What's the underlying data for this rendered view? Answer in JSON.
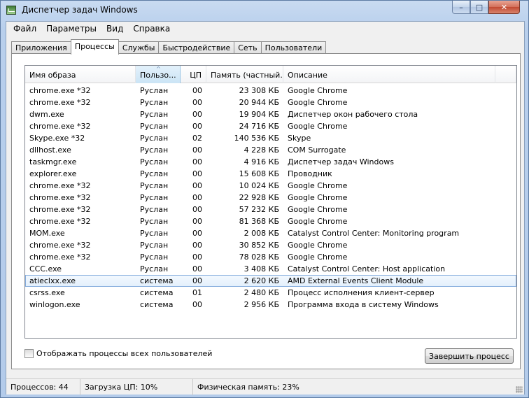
{
  "window": {
    "title": "Диспетчер задач Windows",
    "close_glyph": "✕",
    "max_glyph": "□",
    "min_glyph": "–"
  },
  "menu": [
    "Файл",
    "Параметры",
    "Вид",
    "Справка"
  ],
  "tabs": [
    "Приложения",
    "Процессы",
    "Службы",
    "Быстродействие",
    "Сеть",
    "Пользователи"
  ],
  "active_tab": 1,
  "columns": {
    "name": "Имя образа",
    "user": "Пользо...",
    "cpu": "ЦП",
    "memory": "Память (частный...",
    "description": "Описание",
    "sort_glyph": "^"
  },
  "processes": [
    {
      "name": "chrome.exe *32",
      "user": "Руслан",
      "cpu": "00",
      "memory": "23 308 КБ",
      "description": "Google Chrome"
    },
    {
      "name": "chrome.exe *32",
      "user": "Руслан",
      "cpu": "00",
      "memory": "20 944 КБ",
      "description": "Google Chrome"
    },
    {
      "name": "dwm.exe",
      "user": "Руслан",
      "cpu": "00",
      "memory": "19 904 КБ",
      "description": "Диспетчер окон рабочего стола"
    },
    {
      "name": "chrome.exe *32",
      "user": "Руслан",
      "cpu": "00",
      "memory": "24 716 КБ",
      "description": "Google Chrome"
    },
    {
      "name": "Skype.exe *32",
      "user": "Руслан",
      "cpu": "02",
      "memory": "140 536 КБ",
      "description": "Skype"
    },
    {
      "name": "dllhost.exe",
      "user": "Руслан",
      "cpu": "00",
      "memory": "4 228 КБ",
      "description": "COM Surrogate"
    },
    {
      "name": "taskmgr.exe",
      "user": "Руслан",
      "cpu": "00",
      "memory": "4 916 КБ",
      "description": "Диспетчер задач Windows"
    },
    {
      "name": "explorer.exe",
      "user": "Руслан",
      "cpu": "00",
      "memory": "15 608 КБ",
      "description": "Проводник"
    },
    {
      "name": "chrome.exe *32",
      "user": "Руслан",
      "cpu": "00",
      "memory": "10 024 КБ",
      "description": "Google Chrome"
    },
    {
      "name": "chrome.exe *32",
      "user": "Руслан",
      "cpu": "00",
      "memory": "22 928 КБ",
      "description": "Google Chrome"
    },
    {
      "name": "chrome.exe *32",
      "user": "Руслан",
      "cpu": "00",
      "memory": "57 232 КБ",
      "description": "Google Chrome"
    },
    {
      "name": "chrome.exe *32",
      "user": "Руслан",
      "cpu": "00",
      "memory": "81 368 КБ",
      "description": "Google Chrome"
    },
    {
      "name": "MOM.exe",
      "user": "Руслан",
      "cpu": "00",
      "memory": "2 008 КБ",
      "description": "Catalyst Control Center: Monitoring program"
    },
    {
      "name": "chrome.exe *32",
      "user": "Руслан",
      "cpu": "00",
      "memory": "30 852 КБ",
      "description": "Google Chrome"
    },
    {
      "name": "chrome.exe *32",
      "user": "Руслан",
      "cpu": "00",
      "memory": "78 028 КБ",
      "description": "Google Chrome"
    },
    {
      "name": "CCC.exe",
      "user": "Руслан",
      "cpu": "00",
      "memory": "3 408 КБ",
      "description": "Catalyst Control Center: Host application"
    },
    {
      "name": "atieclxx.exe",
      "user": "система",
      "cpu": "00",
      "memory": "2 620 КБ",
      "description": "AMD External Events Client Module",
      "selected": true
    },
    {
      "name": "csrss.exe",
      "user": "система",
      "cpu": "01",
      "memory": "2 480 КБ",
      "description": "Процесс исполнения клиент-сервер"
    },
    {
      "name": "winlogon.exe",
      "user": "система",
      "cpu": "00",
      "memory": "2 956 КБ",
      "description": "Программа входа в систему Windows"
    }
  ],
  "show_all_label": "Отображать процессы всех пользователей",
  "show_all_checked": false,
  "end_process_label": "Завершить процесс",
  "status": {
    "processes": "Процессов: 44",
    "cpu": "Загрузка ЦП: 10%",
    "memory": "Физическая память: 23%"
  }
}
